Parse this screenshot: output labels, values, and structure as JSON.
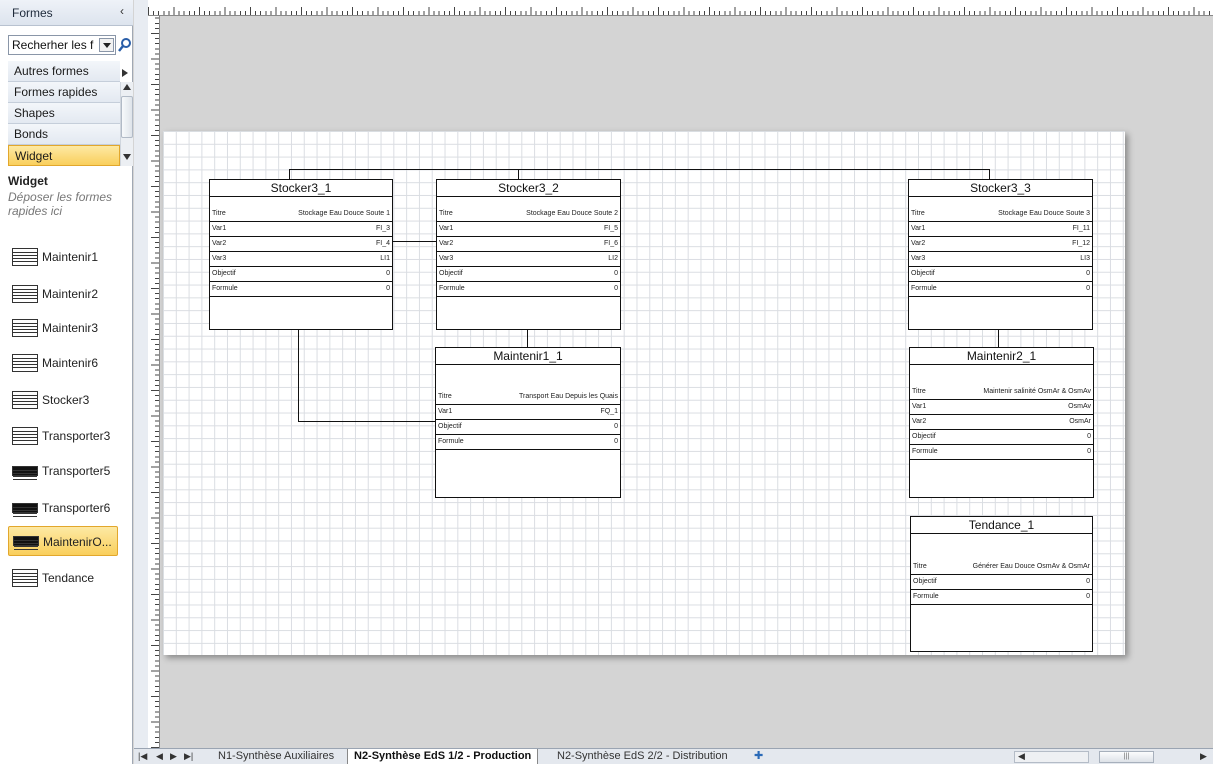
{
  "pane": {
    "title": "Formes",
    "search_value": "Recherher les f",
    "categories": [
      {
        "label": "Autres formes"
      },
      {
        "label": "Formes rapides"
      },
      {
        "label": "Shapes"
      },
      {
        "label": "Bonds"
      },
      {
        "label": "Widget"
      }
    ],
    "stencil_title": "Widget",
    "stencil_hint": "Déposer les formes rapides ici",
    "shapes": [
      {
        "label": "Maintenir1"
      },
      {
        "label": "Maintenir2"
      },
      {
        "label": "Maintenir3"
      },
      {
        "label": "Maintenir6"
      },
      {
        "label": "Stocker3"
      },
      {
        "label": "Transporter3"
      },
      {
        "label": "Transporter5"
      },
      {
        "label": "Transporter6"
      },
      {
        "label": "MaintenirO..."
      },
      {
        "label": "Tendance"
      }
    ]
  },
  "widgets": {
    "stocker3_1": {
      "title": "Stocker3_1",
      "rows": [
        {
          "k": "Titre",
          "v": "Stockage Eau Douce Soute 1"
        },
        {
          "k": "Var1",
          "v": "FI_3"
        },
        {
          "k": "Var2",
          "v": "FI_4"
        },
        {
          "k": "Var3",
          "v": "LI1"
        },
        {
          "k": "Objectif",
          "v": "0"
        },
        {
          "k": "Formule",
          "v": "0"
        }
      ]
    },
    "stocker3_2": {
      "title": "Stocker3_2",
      "rows": [
        {
          "k": "Titre",
          "v": "Stockage Eau Douce Soute 2"
        },
        {
          "k": "Var1",
          "v": "FI_5"
        },
        {
          "k": "Var2",
          "v": "FI_6"
        },
        {
          "k": "Var3",
          "v": "LI2"
        },
        {
          "k": "Objectif",
          "v": "0"
        },
        {
          "k": "Formule",
          "v": "0"
        }
      ]
    },
    "stocker3_3": {
      "title": "Stocker3_3",
      "rows": [
        {
          "k": "Titre",
          "v": "Stockage Eau Douce Soute 3"
        },
        {
          "k": "Var1",
          "v": "FI_11"
        },
        {
          "k": "Var2",
          "v": "FI_12"
        },
        {
          "k": "Var3",
          "v": "LI3"
        },
        {
          "k": "Objectif",
          "v": "0"
        },
        {
          "k": "Formule",
          "v": "0"
        }
      ]
    },
    "maintenir1_1": {
      "title": "Maintenir1_1",
      "rows": [
        {
          "k": "Titre",
          "v": "Transport Eau Depuis les Quais"
        },
        {
          "k": "Var1",
          "v": "FQ_1"
        },
        {
          "k": "Objectif",
          "v": "0"
        },
        {
          "k": "Formule",
          "v": "0"
        }
      ]
    },
    "maintenir2_1": {
      "title": "Maintenir2_1",
      "rows": [
        {
          "k": "Titre",
          "v": "Maintenir salinité OsmAr & OsmAv"
        },
        {
          "k": "Var1",
          "v": "OsmAv"
        },
        {
          "k": "Var2",
          "v": "OsmAr"
        },
        {
          "k": "Objectif",
          "v": "0"
        },
        {
          "k": "Formule",
          "v": "0"
        }
      ]
    },
    "tendance_1": {
      "title": "Tendance_1",
      "rows": [
        {
          "k": "Titre",
          "v": "Générer Eau Douce OsmAv & OsmAr"
        },
        {
          "k": "Objectif",
          "v": "0"
        },
        {
          "k": "Formule",
          "v": "0"
        }
      ]
    }
  },
  "tabs": [
    {
      "label": "N1-Synthèse Auxiliaires"
    },
    {
      "label": "N2-Synthèse EdS 1/2 - Production"
    },
    {
      "label": "N2-Synthèse EdS 2/2 - Distribution"
    }
  ],
  "colors": {
    "selected_fill": "#f9cf5c",
    "selected_border": "#e2a72c"
  }
}
